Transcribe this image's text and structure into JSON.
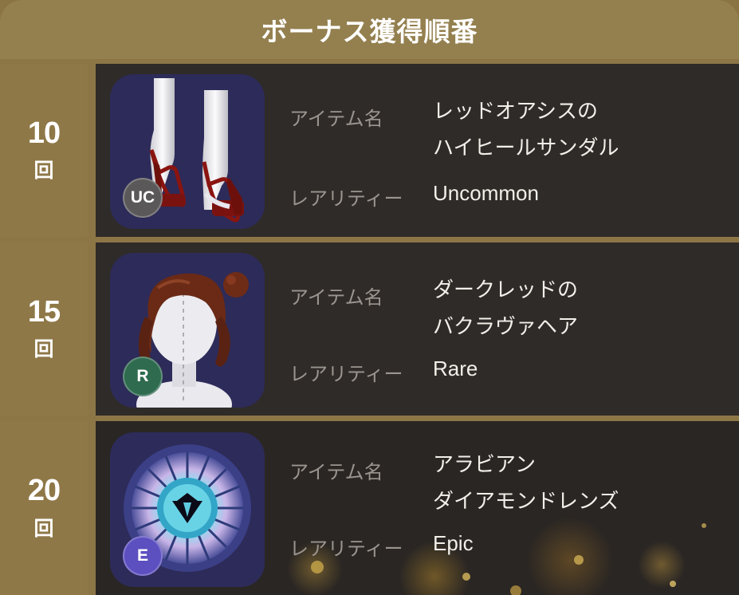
{
  "header": {
    "title": "ボーナス獲得順番"
  },
  "labels": {
    "item_name": "アイテム名",
    "rarity": "レアリティー"
  },
  "rows": [
    {
      "count": "10",
      "unit": "回",
      "name_line1": "レッドオアシスの",
      "name_line2": "ハイヒールサンダル",
      "rarity": "Uncommon",
      "badge": "UC",
      "badge_color": "#5a5858",
      "icon": "high-heel-sandals-icon"
    },
    {
      "count": "15",
      "unit": "回",
      "name_line1": "ダークレッドの",
      "name_line2": "バクラヴァヘア",
      "rarity": "Rare",
      "badge": "R",
      "badge_color": "#2f6b4f",
      "icon": "hair-style-icon"
    },
    {
      "count": "20",
      "unit": "回",
      "name_line1": "アラビアン",
      "name_line2": "ダイアモンドレンズ",
      "rarity": "Epic",
      "badge": "E",
      "badge_color": "#5c4fc0",
      "icon": "diamond-lens-icon"
    }
  ],
  "colors": {
    "gold_frame": "#8f7848",
    "row_background": "#2f2b28",
    "thumbnail_background": "#2d2b59"
  }
}
